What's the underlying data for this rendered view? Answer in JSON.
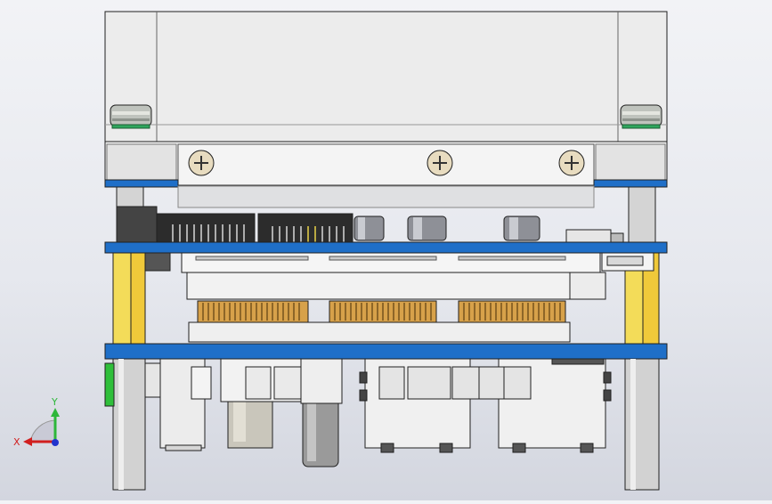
{
  "viewport": {
    "background_top": "#f2f3f6",
    "background_bottom": "#d3d6df"
  },
  "model": {
    "type": "3d-cad-assembly",
    "view": "front",
    "colors": {
      "pcb_blue": "#1f6fc8",
      "standoff_yellow": "#f3dc59",
      "header_gold": "#d7a14a",
      "connector_black": "#2c2c2c",
      "housing_gray": "#eaeaea",
      "green_part": "#2fbf3a",
      "edge_line": "#202020"
    },
    "components": {
      "heatsink": "heatsink",
      "mounting_plate": "mounting-plate",
      "screw_heads": 3,
      "top_pcb": "top-pcb",
      "bottom_pcb": "bottom-pcb",
      "pin_headers": 3,
      "electrolytic_capacitors": 3,
      "ports": 4
    }
  },
  "triad": {
    "x_label": "X",
    "y_label": "Y",
    "x_color": "#d11f1f",
    "y_color": "#2db73a",
    "z_color": "#2233cc"
  }
}
